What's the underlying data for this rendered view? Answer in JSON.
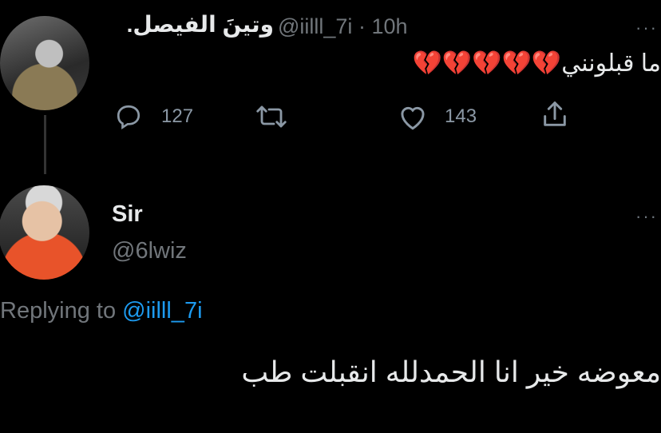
{
  "tweet1": {
    "display_name": "وتينَ الفيصل.",
    "handle": "@iilll_7i",
    "separator": "·",
    "time": "10h",
    "text": "ما قبلونني",
    "emojis": "💔💔💔💔💔",
    "replies": "127",
    "likes": "143"
  },
  "tweet2": {
    "display_name": "Sir",
    "handle": "@6lwiz",
    "replying_prefix": "Replying to",
    "replying_handle": "@iilll_7i",
    "text": "معوضه خير انا الحمدلله انقبلت طب"
  },
  "icons": {
    "more": "more-options-icon",
    "reply": "reply-icon",
    "retweet": "retweet-icon",
    "like": "heart-icon",
    "share": "share-icon"
  },
  "colors": {
    "background": "#000000",
    "text": "#e7e9ea",
    "muted": "#71767b",
    "link": "#1d9bf0"
  }
}
